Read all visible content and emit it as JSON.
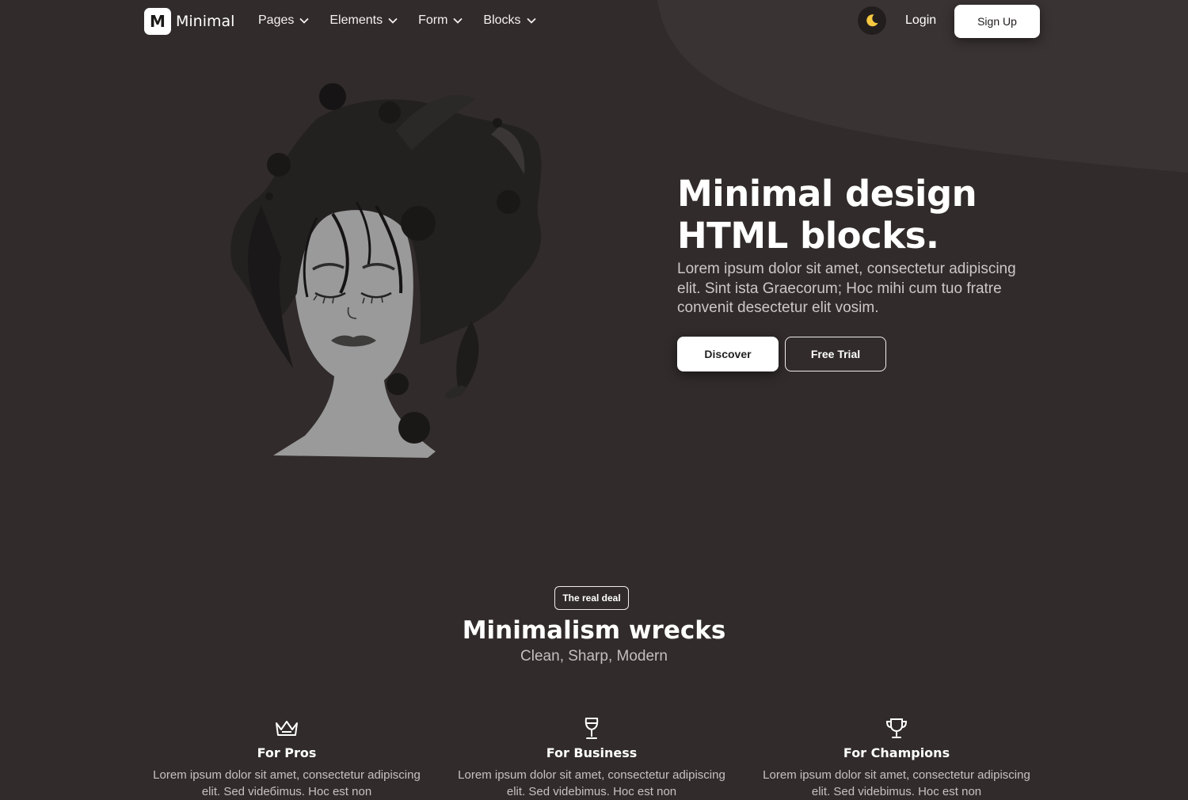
{
  "brand": {
    "mark": "M",
    "name": "Minimal"
  },
  "nav": {
    "items": [
      {
        "label": "Pages"
      },
      {
        "label": "Elements"
      },
      {
        "label": "Form"
      },
      {
        "label": "Blocks"
      }
    ],
    "theme_icon": "moon-icon",
    "login_label": "Login",
    "signup_label": "Sign Up"
  },
  "hero": {
    "title_line1": "Minimal design",
    "title_line2": "HTML blocks.",
    "text": "Lorem ipsum dolor sit amet, consectetur adipiscing elit. Sint ista Graecorum; Hoc mihi cum tuo fratre convenit desectetur elit vosim.",
    "discover_label": "Discover",
    "trial_label": "Free Trial"
  },
  "section": {
    "badge": "The real deal",
    "title": "Minimalism wrecks",
    "subtitle": "Clean, Sharp, Modern"
  },
  "features": [
    {
      "icon": "crown-icon",
      "title": "For Pros",
      "text": "Lorem ipsum dolor sit amet, consectetur adipiscing elit. Sed vidебimus. Hoc est non"
    },
    {
      "icon": "wine-glass-icon",
      "title": "For Business",
      "text": "Lorem ipsum dolor sit amet, consectetur adipiscing elit. Sed videbimus. Hoc est non"
    },
    {
      "icon": "trophy-icon",
      "title": "For Champions",
      "text": "Lorem ipsum dolor sit amet, consectetur adipiscing elit. Sed videbimus. Hoc est non"
    }
  ],
  "colors": {
    "background": "#312b2b",
    "curve": "#3a3333",
    "accent_moon": "#f5c842",
    "button_light": "#ffffff"
  }
}
